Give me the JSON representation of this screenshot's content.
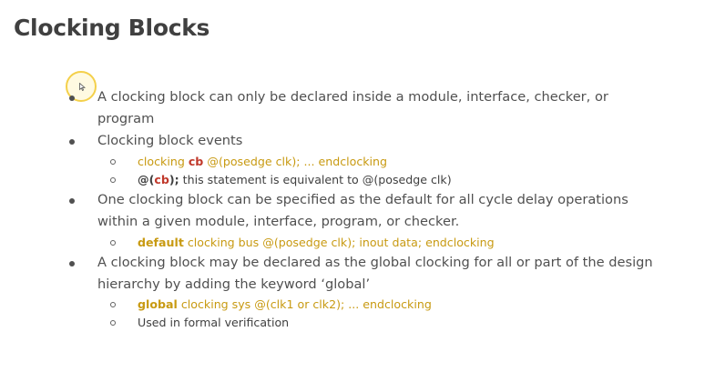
{
  "title": "Clocking Blocks",
  "bullets": [
    {
      "line1": "A clocking block can only be declared inside a module, interface, checker, or",
      "line2": "program"
    },
    {
      "line1": "Clocking block events"
    },
    {
      "line1": "One clocking block can be specified as the default for all cycle delay operations",
      "line2": "within a given module, interface, program, or checker."
    },
    {
      "line1": "A clocking block may be declared as the global clocking for all or part of the design",
      "line2": "hierarchy  by adding the keyword ‘global’"
    }
  ],
  "sub": {
    "ev1": {
      "kw1": "clocking",
      "name": "cb",
      "rest": "@(posedge clk);   ... endclocking"
    },
    "ev2": {
      "at": "@(",
      "name": "cb",
      "close": ");",
      "rest": "this  statement is equivalent to @(posedge clk)"
    },
    "def": {
      "kw": "default",
      "rest": "clocking bus @(posedge clk);   inout data;   endclocking"
    },
    "glob": {
      "kw": "global",
      "rest": "clocking sys @(clk1 or clk2); ... endclocking"
    },
    "formal": "Used in formal verification"
  },
  "colors": {
    "code": "#c89a12",
    "highlight": "#c0392b",
    "text": "#505050"
  },
  "cursor_icon": "mouse-pointer-icon"
}
